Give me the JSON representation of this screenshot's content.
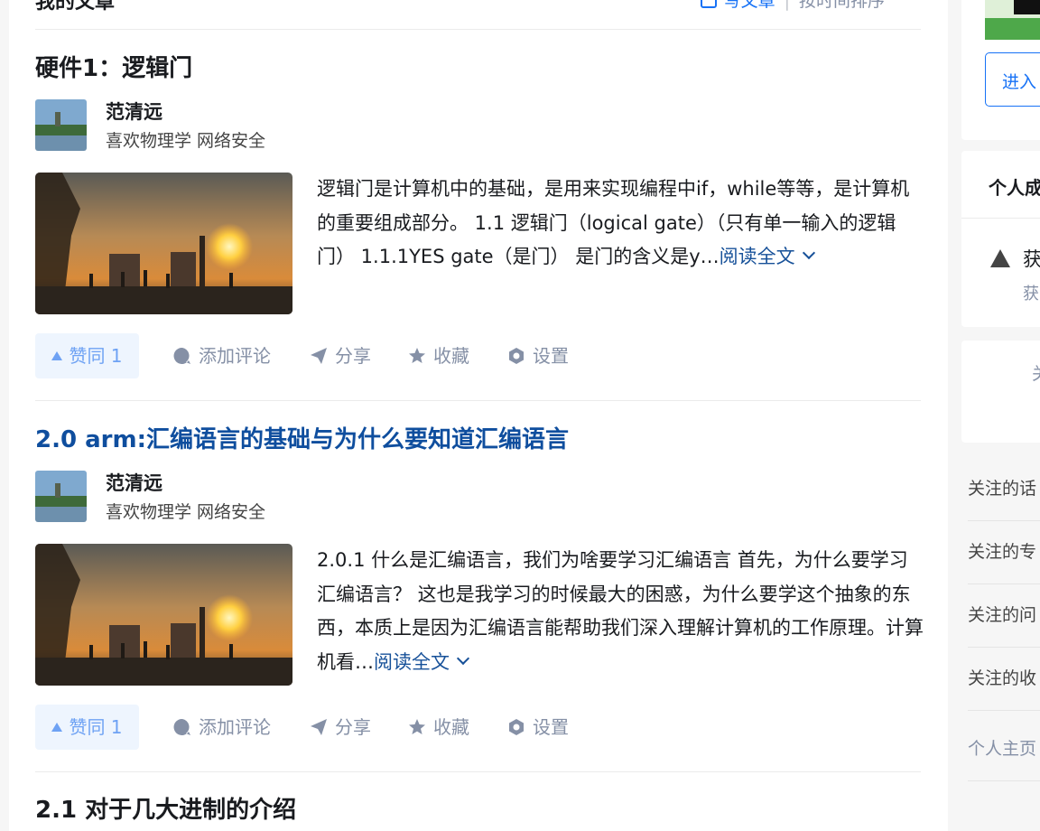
{
  "section": {
    "title": "我的文章",
    "write_label": "写文章",
    "sort_label": "按时间排序"
  },
  "articles": [
    {
      "title": "硬件1：逻辑门",
      "author": "范清远",
      "bio": "喜欢物理学 网络安全",
      "excerpt": "逻辑门是计算机中的基础，是用来实现编程中if，while等等，是计算机的重要组成部分。 1.1 逻辑门（logical gate）（只有单一输入的逻辑门） 1.1.1YES gate（是门） 是门的含义是y…",
      "read_more": "阅读全文",
      "vote": "赞同 1",
      "comment": "添加评论",
      "share": "分享",
      "favorite": "收藏",
      "settings": "设置"
    },
    {
      "title": "2.0 arm:汇编语言的基础与为什么要知道汇编语言",
      "author": "范清远",
      "bio": "喜欢物理学 网络安全",
      "excerpt": "2.0.1 什么是汇编语言，我们为啥要学习汇编语言 首先，为什么要学习汇编语言？ 这也是我学习的时候最大的困惑，为什么要学这个抽象的东西，本质上是因为汇编语言能帮助我们深入理解计算机的工作原理。计算机看…",
      "read_more": "阅读全文",
      "vote": "赞同 1",
      "comment": "添加评论",
      "share": "分享",
      "favorite": "收藏",
      "settings": "设置"
    },
    {
      "title": "2.1 对于几大进制的介绍"
    }
  ],
  "sidebar": {
    "enter_button": "进入",
    "achievements_title": "个人成",
    "achievement_text": "获",
    "achievement_sub": "获",
    "follow_card_text": "关",
    "links": [
      "关注的话",
      "关注的专",
      "关注的问",
      "关注的收",
      "个人主页"
    ]
  }
}
